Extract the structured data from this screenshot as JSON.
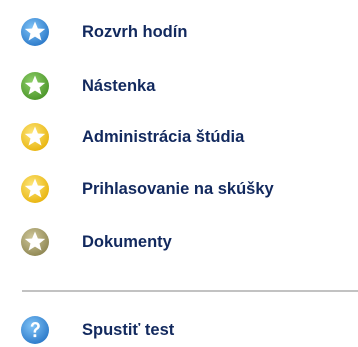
{
  "menu": {
    "items": [
      {
        "label": "Rozvrh hodín",
        "icon": "star-icon-blue",
        "color": "#3a8fd8",
        "glyph": "star"
      },
      {
        "label": "Nástenka",
        "icon": "star-icon-green",
        "color": "#5aa532",
        "glyph": "star"
      },
      {
        "label": "Administrácia štúdia",
        "icon": "star-icon-yellow",
        "color": "#f2c318",
        "glyph": "star"
      },
      {
        "label": "Prihlasovanie na skúšky",
        "icon": "star-icon-yellow",
        "color": "#f2c318",
        "glyph": "star"
      },
      {
        "label": "Dokumenty",
        "icon": "star-icon-olive",
        "color": "#a39b64",
        "glyph": "star"
      }
    ],
    "footer_item": {
      "label": "Spustiť test",
      "icon": "question-icon-blue",
      "color": "#3a8fd8",
      "glyph": "question"
    }
  }
}
